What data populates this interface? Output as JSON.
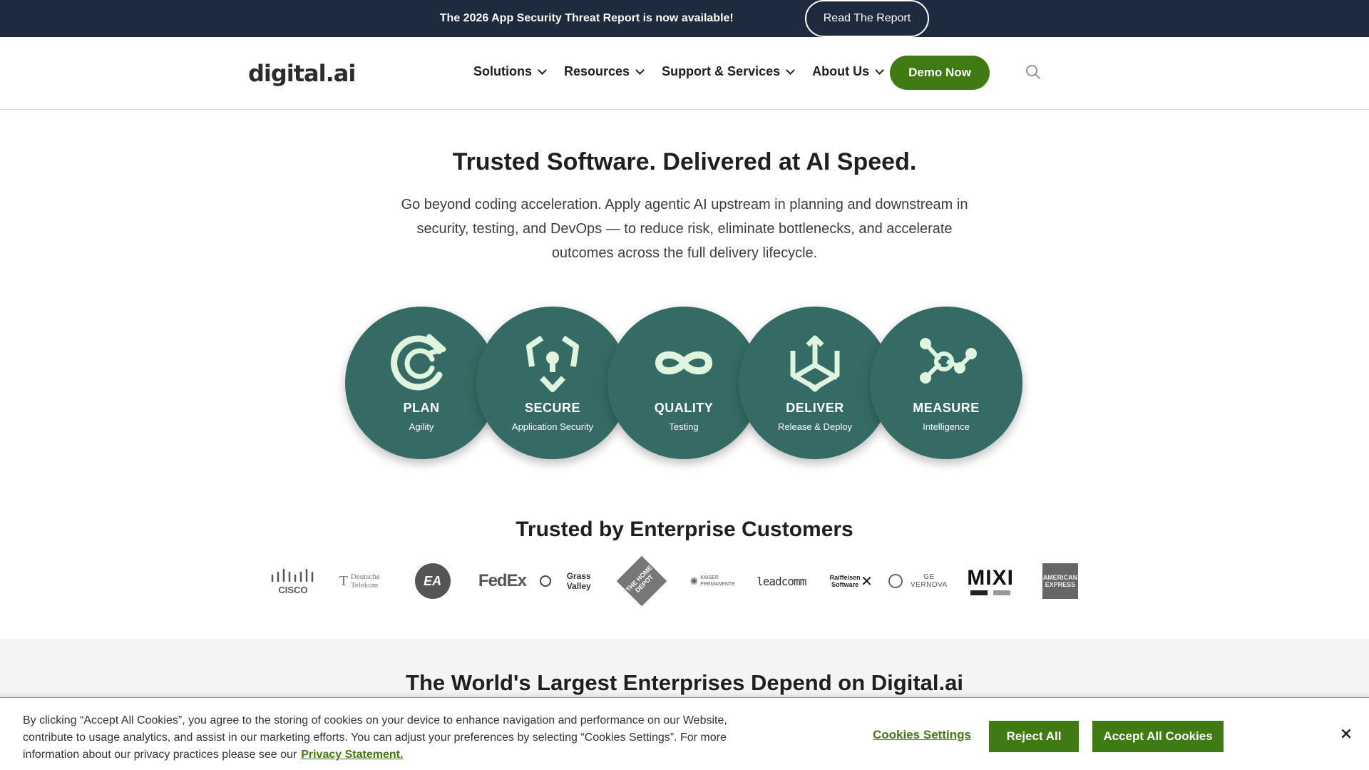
{
  "banner": {
    "text": "The 2026 App Security Threat Report is now available!",
    "button_label": "Read The Report"
  },
  "header": {
    "logo": "digital.ai",
    "nav": [
      {
        "label": "Solutions"
      },
      {
        "label": "Resources"
      },
      {
        "label": "Support & Services"
      },
      {
        "label": "About Us"
      }
    ],
    "demo_label": "Demo Now",
    "search_icon": "search-icon"
  },
  "hero": {
    "title": "Trusted Software. Delivered at AI Speed.",
    "subtitle": "Go beyond coding acceleration. Apply agentic AI upstream in planning and downstream in security, testing, and DevOps — to reduce risk, eliminate bottlenecks, and accelerate outcomes across the full delivery lifecycle."
  },
  "circles": [
    {
      "title": "PLAN",
      "subtitle": "Agility",
      "icon": "refresh-arrow-icon"
    },
    {
      "title": "SECURE",
      "subtitle": "Application Security",
      "icon": "shield-keyhole-icon"
    },
    {
      "title": "QUALITY",
      "subtitle": "Testing",
      "icon": "infinity-icon"
    },
    {
      "title": "DELIVER",
      "subtitle": "Release & Deploy",
      "icon": "cube-arrows-icon"
    },
    {
      "title": "MEASURE",
      "subtitle": "Intelligence",
      "icon": "network-nodes-icon"
    }
  ],
  "colors": {
    "banner_bg": "#1e2b3e",
    "accent_green": "#3f7a12",
    "circle_teal": "#356b64",
    "icon_mint": "#dff5df",
    "gray_section": "#f3f4f6"
  },
  "trusted": {
    "title": "Trusted by Enterprise Customers",
    "logos": [
      {
        "name": "cisco-logo",
        "text": "CISCO"
      },
      {
        "name": "deutsche-telekom-logo",
        "text": "Deutsche Telekom"
      },
      {
        "name": "ea-logo",
        "text": "EA"
      },
      {
        "name": "fedex-logo",
        "text": "FedEx"
      },
      {
        "name": "grass-valley-logo",
        "text": "Grass Valley"
      },
      {
        "name": "home-depot-logo",
        "text": "THE HOME DEPOT"
      },
      {
        "name": "kaiser-permanente-logo",
        "text": "KAISER PERMANENTE"
      },
      {
        "name": "leadcomm-logo",
        "text": "leadcomm"
      },
      {
        "name": "raiffeisen-software-logo",
        "text": "Raiffeisen Software"
      },
      {
        "name": "ge-vernova-logo",
        "text": "GE VERNOVA"
      },
      {
        "name": "mixi-logo",
        "text": "MIXI"
      },
      {
        "name": "american-express-logo",
        "text": "AMERICAN EXPRESS"
      }
    ]
  },
  "section": {
    "title": "The World's Largest Enterprises Depend on Digital.ai"
  },
  "cookie": {
    "text": "By clicking “Accept All Cookies”, you agree to the storing of cookies on your device to enhance navigation and performance on our Website, contribute to usage analytics, and assist in our marketing efforts. You can adjust your preferences by selecting “Cookies Settings”. For more information about our privacy practices please see our",
    "link": "Privacy Statement.",
    "settings_label": "Cookies Settings",
    "reject_label": "Reject All",
    "accept_label": "Accept All Cookies",
    "close_label": "×"
  }
}
